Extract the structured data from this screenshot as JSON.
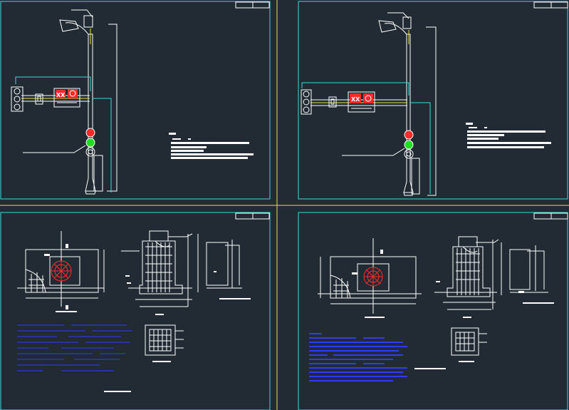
{
  "sheets": [
    {
      "id": "top-left",
      "type": "pole-elevation"
    },
    {
      "id": "top-right",
      "type": "pole-elevation"
    },
    {
      "id": "bottom-left",
      "type": "foundation-detail"
    },
    {
      "id": "bottom-right",
      "type": "foundation-detail"
    }
  ],
  "sign_text": "XX",
  "colors": {
    "background": "#222b33",
    "frame": "#3fd9d9",
    "divider": "#e8e040",
    "lines": "#ffffff",
    "signal_red": "#ff2a2a",
    "signal_green": "#22dd22",
    "notes_blue": "#2f3cff"
  },
  "icons": [
    "street-lamp-icon",
    "traffic-signal-head-icon",
    "rebar-cage-icon"
  ]
}
